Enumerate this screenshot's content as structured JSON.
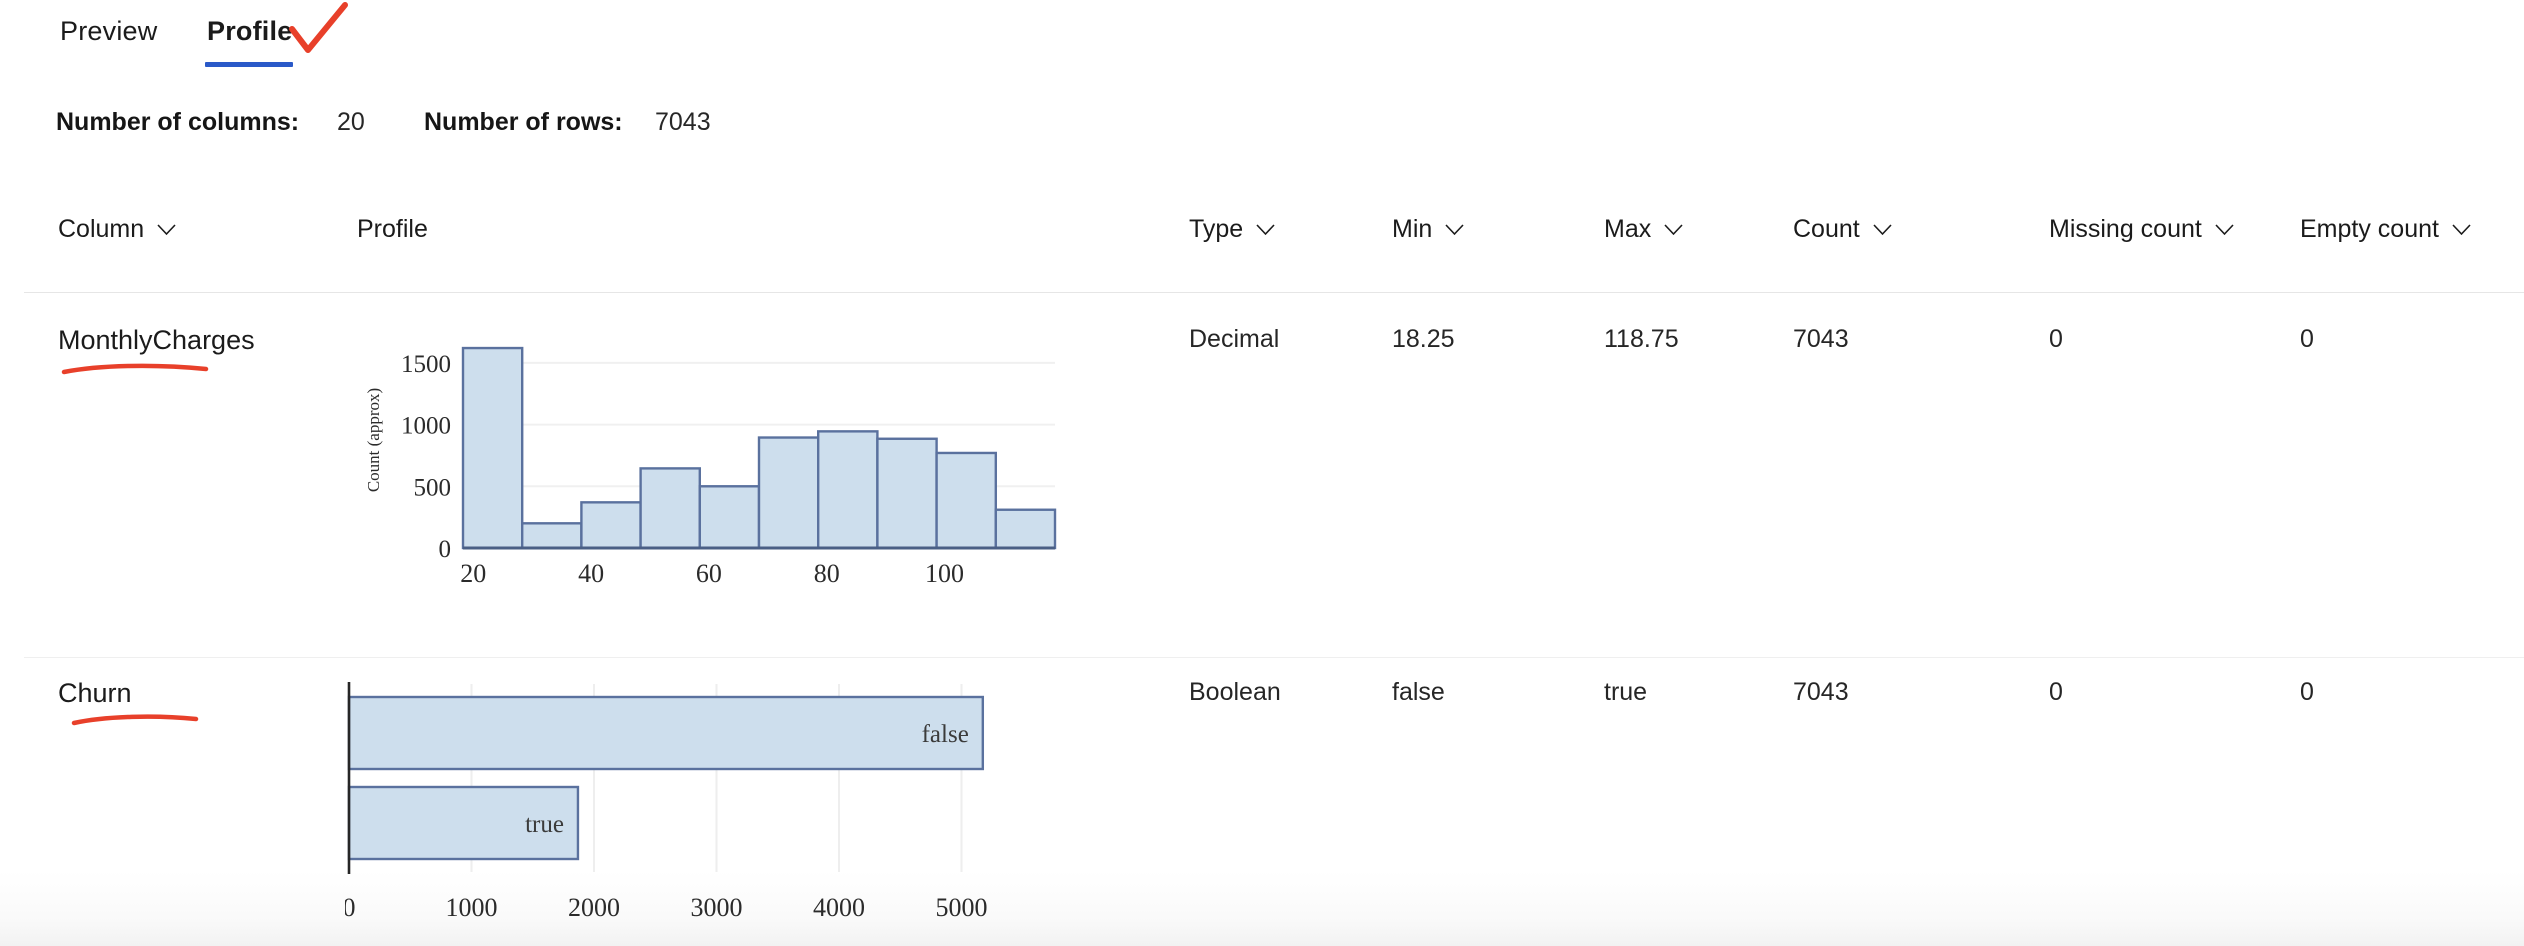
{
  "tabs": [
    {
      "id": "preview",
      "label": "Preview",
      "active": false
    },
    {
      "id": "profile",
      "label": "Profile",
      "active": true
    }
  ],
  "annotations": {
    "checkmark_color": "#e8402a",
    "underline_color": "#e8402a",
    "tab_accent_color": "#2a59c8"
  },
  "summary": {
    "columns_label": "Number of columns:",
    "columns_value": "20",
    "rows_label": "Number of rows:",
    "rows_value": "7043"
  },
  "table": {
    "headers": [
      {
        "id": "column",
        "label": "Column",
        "sortable": true
      },
      {
        "id": "profile",
        "label": "Profile",
        "sortable": false
      },
      {
        "id": "type",
        "label": "Type",
        "sortable": true
      },
      {
        "id": "min",
        "label": "Min",
        "sortable": true
      },
      {
        "id": "max",
        "label": "Max",
        "sortable": true
      },
      {
        "id": "count",
        "label": "Count",
        "sortable": true
      },
      {
        "id": "missing_count",
        "label": "Missing count",
        "sortable": true
      },
      {
        "id": "empty_count",
        "label": "Empty count",
        "sortable": true
      }
    ],
    "rows": [
      {
        "column": "MonthlyCharges",
        "type": "Decimal",
        "min": "18.25",
        "max": "118.75",
        "count": "7043",
        "missing_count": "0",
        "empty_count": "0"
      },
      {
        "column": "Churn",
        "type": "Boolean",
        "min": "false",
        "max": "true",
        "count": "7043",
        "missing_count": "0",
        "empty_count": "0"
      }
    ]
  },
  "chart_data": [
    {
      "id": "monthlycharges-histogram",
      "type": "bar",
      "orientation": "vertical",
      "title": "",
      "xlabel": "",
      "ylabel": "Count (approx)",
      "bin_edges": [
        18.25,
        28.3,
        38.35,
        48.4,
        58.45,
        68.5,
        78.55,
        88.6,
        98.65,
        108.7,
        118.75
      ],
      "bin_centers": [
        23.3,
        33.3,
        43.4,
        53.4,
        63.5,
        73.5,
        83.6,
        93.6,
        103.7,
        113.7
      ],
      "values": [
        1620,
        200,
        370,
        645,
        500,
        895,
        945,
        885,
        770,
        310
      ],
      "xticks": [
        20,
        40,
        60,
        80,
        100
      ],
      "xtick_labels": [
        "20",
        "40",
        "60",
        "80",
        "100"
      ],
      "yticks": [
        0,
        500,
        1000,
        1500
      ],
      "ytick_labels": [
        "0",
        "500",
        "1000",
        "1500"
      ],
      "ylim": [
        0,
        1750
      ],
      "xlim": [
        18.25,
        118.75
      ],
      "grid": true,
      "legend": false,
      "bar_fill": "#cddeed",
      "bar_stroke": "#5a719e"
    },
    {
      "id": "churn-bar",
      "type": "bar",
      "orientation": "horizontal",
      "title": "",
      "xlabel": "",
      "ylabel": "",
      "categories": [
        "false",
        "true"
      ],
      "values": [
        5174,
        1869
      ],
      "xticks": [
        0,
        1000,
        2000,
        3000,
        4000,
        5000
      ],
      "xtick_labels": [
        "0",
        "1000",
        "2000",
        "3000",
        "4000",
        "5000"
      ],
      "xlim": [
        0,
        5600
      ],
      "grid": true,
      "legend": false,
      "bar_fill": "#cddeed",
      "bar_stroke": "#5a719e",
      "label_color": "#3b3b3b"
    }
  ]
}
